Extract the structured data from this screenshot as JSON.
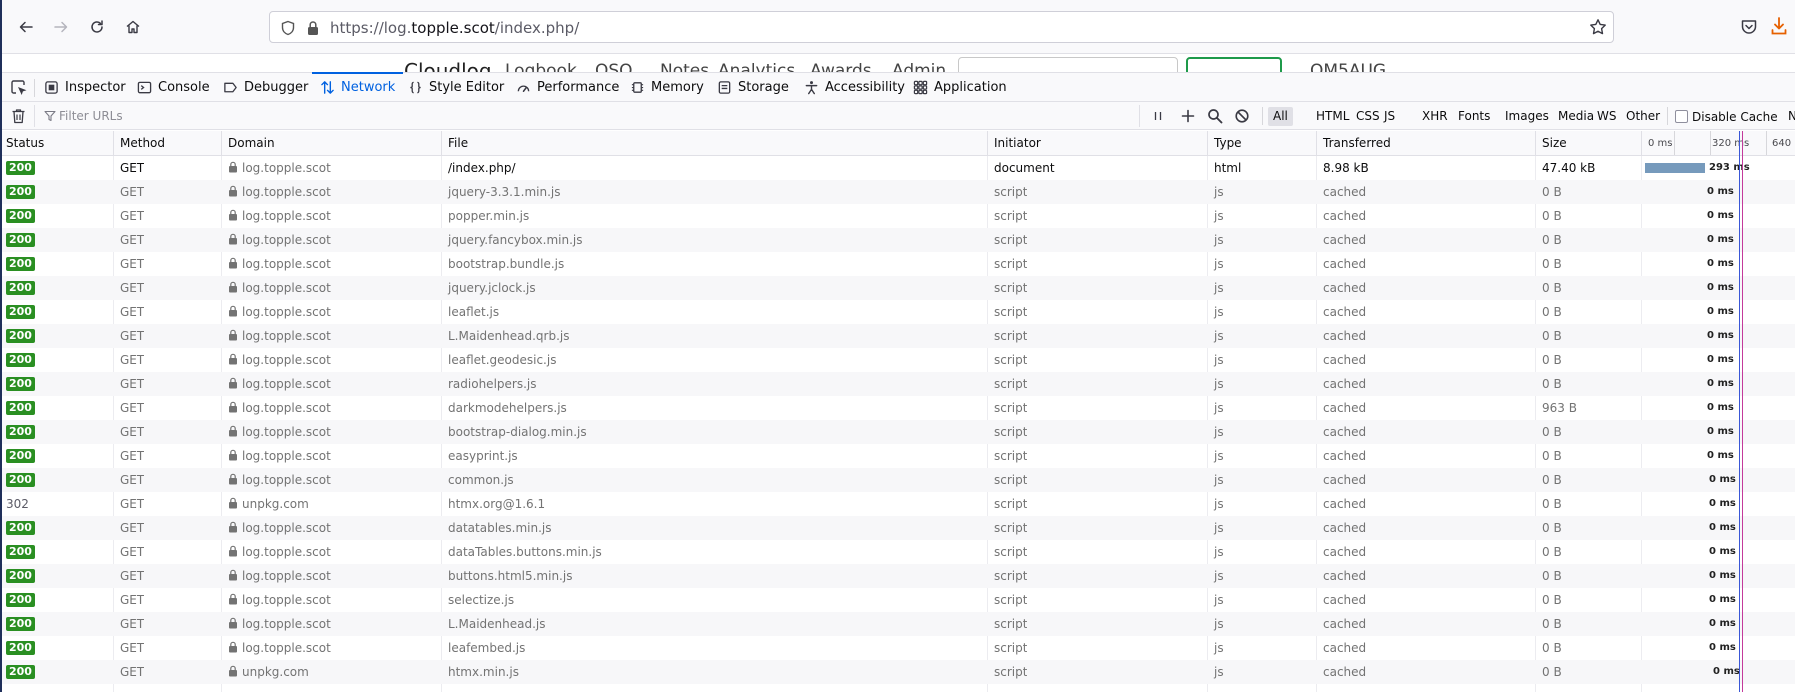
{
  "browser": {
    "url_prefix": "https://log.",
    "url_domain": "topple.scot",
    "url_path": "/index.php/"
  },
  "page_peek": {
    "texts": [
      "Cloudlog",
      "Logbook",
      "QSO",
      "Notes",
      "Analytics",
      "Awards",
      "Admin",
      "OM5AUG"
    ]
  },
  "devtools": {
    "tabs": [
      {
        "label": "Inspector",
        "icon": "inspector-icon"
      },
      {
        "label": "Console",
        "icon": "console-icon"
      },
      {
        "label": "Debugger",
        "icon": "debugger-icon"
      },
      {
        "label": "Network",
        "icon": "network-icon",
        "active": true
      },
      {
        "label": "Style Editor",
        "icon": "style-editor-icon"
      },
      {
        "label": "Performance",
        "icon": "performance-icon"
      },
      {
        "label": "Memory",
        "icon": "memory-icon"
      },
      {
        "label": "Storage",
        "icon": "storage-icon"
      },
      {
        "label": "Accessibility",
        "icon": "accessibility-icon"
      },
      {
        "label": "Application",
        "icon": "application-icon"
      }
    ]
  },
  "network": {
    "filter_placeholder": "Filter URLs",
    "filter_types": [
      "All",
      "HTML",
      "CSS",
      "JS",
      "XHR",
      "Fonts",
      "Images",
      "Media",
      "WS",
      "Other"
    ],
    "active_filter": "All",
    "disable_cache_label": "Disable Cache",
    "disable_cache_checked": false,
    "overflow_glyph": "N",
    "columns": [
      "Status",
      "Method",
      "Domain",
      "File",
      "Initiator",
      "Type",
      "Transferred",
      "Size"
    ],
    "waterfall_ticks": [
      "0 ms",
      "320 ms",
      "640"
    ],
    "rows": [
      {
        "status": "200",
        "method": "GET",
        "domain": "log.topple.scot",
        "file": "/index.php/",
        "initiator": "document",
        "type": "html",
        "transferred": "8.98 kB",
        "size": "47.40 kB",
        "timing": "293 ms",
        "bar_ms": 293
      },
      {
        "status": "200",
        "method": "GET",
        "domain": "log.topple.scot",
        "file": "jquery-3.3.1.min.js",
        "initiator": "script",
        "type": "js",
        "transferred": "cached",
        "size": "0 B",
        "timing": "0 ms"
      },
      {
        "status": "200",
        "method": "GET",
        "domain": "log.topple.scot",
        "file": "popper.min.js",
        "initiator": "script",
        "type": "js",
        "transferred": "cached",
        "size": "0 B",
        "timing": "0 ms"
      },
      {
        "status": "200",
        "method": "GET",
        "domain": "log.topple.scot",
        "file": "jquery.fancybox.min.js",
        "initiator": "script",
        "type": "js",
        "transferred": "cached",
        "size": "0 B",
        "timing": "0 ms"
      },
      {
        "status": "200",
        "method": "GET",
        "domain": "log.topple.scot",
        "file": "bootstrap.bundle.js",
        "initiator": "script",
        "type": "js",
        "transferred": "cached",
        "size": "0 B",
        "timing": "0 ms"
      },
      {
        "status": "200",
        "method": "GET",
        "domain": "log.topple.scot",
        "file": "jquery.jclock.js",
        "initiator": "script",
        "type": "js",
        "transferred": "cached",
        "size": "0 B",
        "timing": "0 ms"
      },
      {
        "status": "200",
        "method": "GET",
        "domain": "log.topple.scot",
        "file": "leaflet.js",
        "initiator": "script",
        "type": "js",
        "transferred": "cached",
        "size": "0 B",
        "timing": "0 ms"
      },
      {
        "status": "200",
        "method": "GET",
        "domain": "log.topple.scot",
        "file": "L.Maidenhead.qrb.js",
        "initiator": "script",
        "type": "js",
        "transferred": "cached",
        "size": "0 B",
        "timing": "0 ms"
      },
      {
        "status": "200",
        "method": "GET",
        "domain": "log.topple.scot",
        "file": "leaflet.geodesic.js",
        "initiator": "script",
        "type": "js",
        "transferred": "cached",
        "size": "0 B",
        "timing": "0 ms"
      },
      {
        "status": "200",
        "method": "GET",
        "domain": "log.topple.scot",
        "file": "radiohelpers.js",
        "initiator": "script",
        "type": "js",
        "transferred": "cached",
        "size": "0 B",
        "timing": "0 ms"
      },
      {
        "status": "200",
        "method": "GET",
        "domain": "log.topple.scot",
        "file": "darkmodehelpers.js",
        "initiator": "script",
        "type": "js",
        "transferred": "cached",
        "size": "963 B",
        "timing": "0 ms"
      },
      {
        "status": "200",
        "method": "GET",
        "domain": "log.topple.scot",
        "file": "bootstrap-dialog.min.js",
        "initiator": "script",
        "type": "js",
        "transferred": "cached",
        "size": "0 B",
        "timing": "0 ms"
      },
      {
        "status": "200",
        "method": "GET",
        "domain": "log.topple.scot",
        "file": "easyprint.js",
        "initiator": "script",
        "type": "js",
        "transferred": "cached",
        "size": "0 B",
        "timing": "0 ms"
      },
      {
        "status": "200",
        "method": "GET",
        "domain": "log.topple.scot",
        "file": "common.js",
        "initiator": "script",
        "type": "js",
        "transferred": "cached",
        "size": "0 B",
        "timing": "0 ms"
      },
      {
        "status": "302",
        "method": "GET",
        "domain": "unpkg.com",
        "file": "htmx.org@1.6.1",
        "initiator": "script",
        "type": "js",
        "transferred": "cached",
        "size": "0 B",
        "timing": "0 ms"
      },
      {
        "status": "200",
        "method": "GET",
        "domain": "log.topple.scot",
        "file": "datatables.min.js",
        "initiator": "script",
        "type": "js",
        "transferred": "cached",
        "size": "0 B",
        "timing": "0 ms"
      },
      {
        "status": "200",
        "method": "GET",
        "domain": "log.topple.scot",
        "file": "dataTables.buttons.min.js",
        "initiator": "script",
        "type": "js",
        "transferred": "cached",
        "size": "0 B",
        "timing": "0 ms"
      },
      {
        "status": "200",
        "method": "GET",
        "domain": "log.topple.scot",
        "file": "buttons.html5.min.js",
        "initiator": "script",
        "type": "js",
        "transferred": "cached",
        "size": "0 B",
        "timing": "0 ms"
      },
      {
        "status": "200",
        "method": "GET",
        "domain": "log.topple.scot",
        "file": "selectize.js",
        "initiator": "script",
        "type": "js",
        "transferred": "cached",
        "size": "0 B",
        "timing": "0 ms"
      },
      {
        "status": "200",
        "method": "GET",
        "domain": "log.topple.scot",
        "file": "L.Maidenhead.js",
        "initiator": "script",
        "type": "js",
        "transferred": "cached",
        "size": "0 B",
        "timing": "0 ms"
      },
      {
        "status": "200",
        "method": "GET",
        "domain": "log.topple.scot",
        "file": "leafembed.js",
        "initiator": "script",
        "type": "js",
        "transferred": "cached",
        "size": "0 B",
        "timing": "0 ms"
      },
      {
        "status": "200",
        "method": "GET",
        "domain": "unpkg.com",
        "file": "htmx.min.js",
        "initiator": "script",
        "type": "js",
        "transferred": "cached",
        "size": "0 B",
        "timing": "0 ms"
      }
    ]
  },
  "colors": {
    "accent": "#0061e0",
    "status_ok": "#2a8f22",
    "waterfall_bar": "#5e88b0",
    "dom_content_loaded_line": "#3a57d6",
    "load_line": "#c33a9b",
    "download_icon": "#e66000"
  }
}
